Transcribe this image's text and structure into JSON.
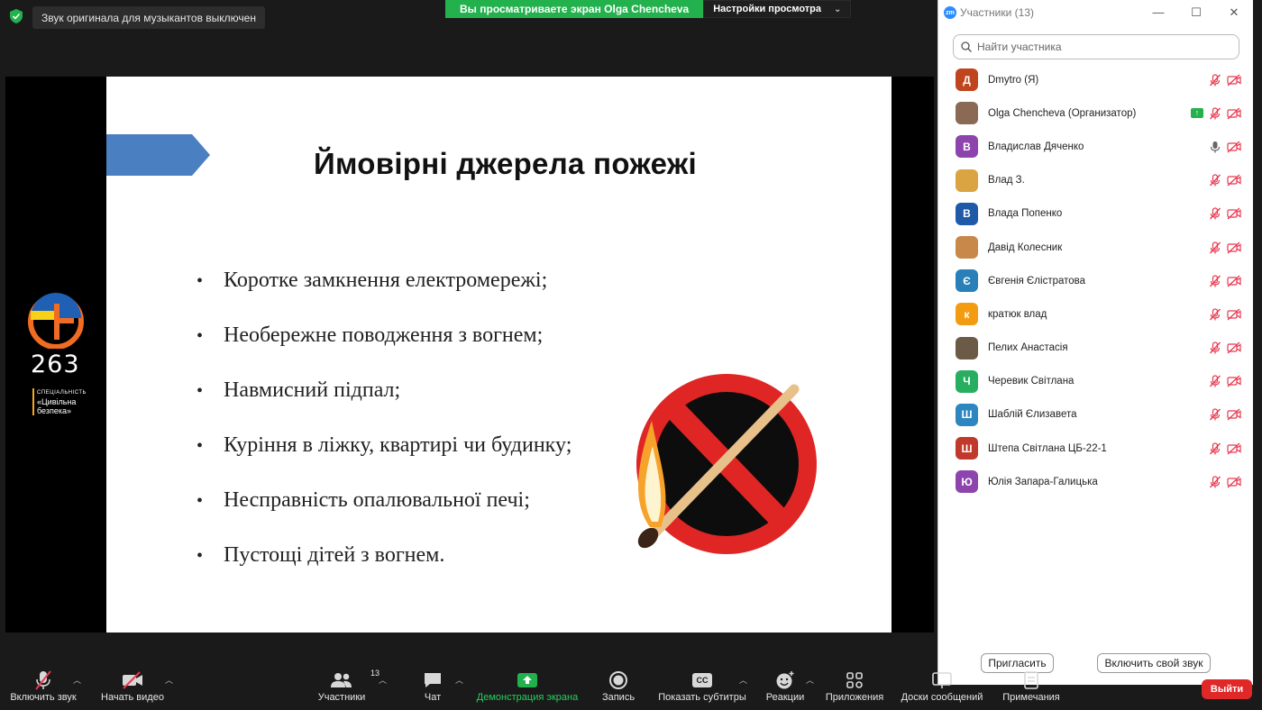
{
  "topbar": {
    "toast": "Звук оригинала для музыкантов выключен",
    "share_banner": "Вы просматриваете экран Olga Chencheva",
    "view_options": "Настройки просмотра"
  },
  "slide": {
    "title": "Ймовірні джерела пожежі",
    "bullets": [
      "Коротке замкнення електромережі;",
      "Необережне поводження з вогнем;",
      "Навмисний підпал;",
      "Куріння в ліжку, квартирі чи будинку;",
      "Несправність опалювальної печі;",
      "Пустощі дітей з вогнем."
    ],
    "logo": {
      "number": "263",
      "caption_small": "СПЕЦІАЛЬНІСТЬ",
      "caption_line1": "«Цивільна",
      "caption_line2": "безпека»"
    }
  },
  "participants_panel": {
    "title": "Участники (13)",
    "search_placeholder": "Найти участника",
    "participants": [
      {
        "initial": "Д",
        "name": "Dmytro (Я)",
        "color": "#c0451f",
        "share": false,
        "mic": "muted"
      },
      {
        "initial": "",
        "name": "Olga Chencheva (Организатор)",
        "color": "#8a6a55",
        "share": true,
        "mic": "muted"
      },
      {
        "initial": "В",
        "name": "Владислав Дяченко",
        "color": "#8e44ad",
        "share": false,
        "mic": "on"
      },
      {
        "initial": "",
        "name": "Влад З.",
        "color": "#d9a441",
        "share": false,
        "mic": "muted"
      },
      {
        "initial": "В",
        "name": "Влада Попенко",
        "color": "#1e5aa8",
        "share": false,
        "mic": "muted"
      },
      {
        "initial": "",
        "name": "Давід Колесник",
        "color": "#c8884a",
        "share": false,
        "mic": "muted"
      },
      {
        "initial": "Є",
        "name": "Євгенія Єлістратова",
        "color": "#2980b9",
        "share": false,
        "mic": "muted"
      },
      {
        "initial": "к",
        "name": "кратюк влад",
        "color": "#f39c12",
        "share": false,
        "mic": "muted"
      },
      {
        "initial": "",
        "name": "Пелих Анастасія",
        "color": "#6b5a45",
        "share": false,
        "mic": "muted"
      },
      {
        "initial": "Ч",
        "name": "Черевик Світлана",
        "color": "#27ae60",
        "share": false,
        "mic": "muted"
      },
      {
        "initial": "Ш",
        "name": "Шаблій Єлизавета",
        "color": "#2e86c1",
        "share": false,
        "mic": "muted"
      },
      {
        "initial": "Ш",
        "name": "Штепа Світлана ЦБ-22-1",
        "color": "#c0392b",
        "share": false,
        "mic": "muted"
      },
      {
        "initial": "Ю",
        "name": "Юлія Запара-Галицька",
        "color": "#8e44ad",
        "share": false,
        "mic": "muted"
      }
    ],
    "invite_button": "Пригласить",
    "unmute_button": "Включить свой звук"
  },
  "toolbar": {
    "unmute": "Включить звук",
    "start_video": "Начать видео",
    "participants": "Участники",
    "participants_count": "13",
    "chat": "Чат",
    "share_screen": "Демонстрация экрана",
    "record": "Запись",
    "captions": "Показать субтитры",
    "captions_icon_text": "CC",
    "reactions": "Реакции",
    "apps": "Приложения",
    "whiteboards": "Доски сообщений",
    "notes": "Примечания",
    "leave": "Выйти"
  },
  "colors": {
    "accent_green": "#23b14d",
    "leave_red": "#e02828",
    "muted_red": "#e8384f"
  }
}
